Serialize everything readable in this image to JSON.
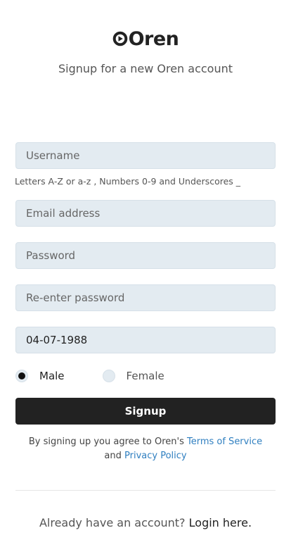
{
  "brand": {
    "name": "Oren",
    "tagline": "Signup for a new Oren account"
  },
  "form": {
    "username_placeholder": "Username",
    "username_hint": "Letters A-Z or a-z , Numbers 0-9 and Underscores _",
    "email_placeholder": "Email address",
    "password_placeholder": "Password",
    "reenter_placeholder": "Re-enter password",
    "dob_value": "04-07-1988",
    "gender": {
      "options": [
        "Male",
        "Female"
      ],
      "selected": "Male"
    },
    "submit_label": "Signup"
  },
  "terms": {
    "prefix": "By signing up you agree to Oren's",
    "tos_link": "Terms of Service",
    "conjunction": "and",
    "privacy_link": "Privacy Policy"
  },
  "login": {
    "prompt": "Already have an account?",
    "link": "Login here."
  },
  "colors": {
    "primary_button": "#222222",
    "input_background": "#e3ebf1",
    "link": "#2f7fc0"
  }
}
